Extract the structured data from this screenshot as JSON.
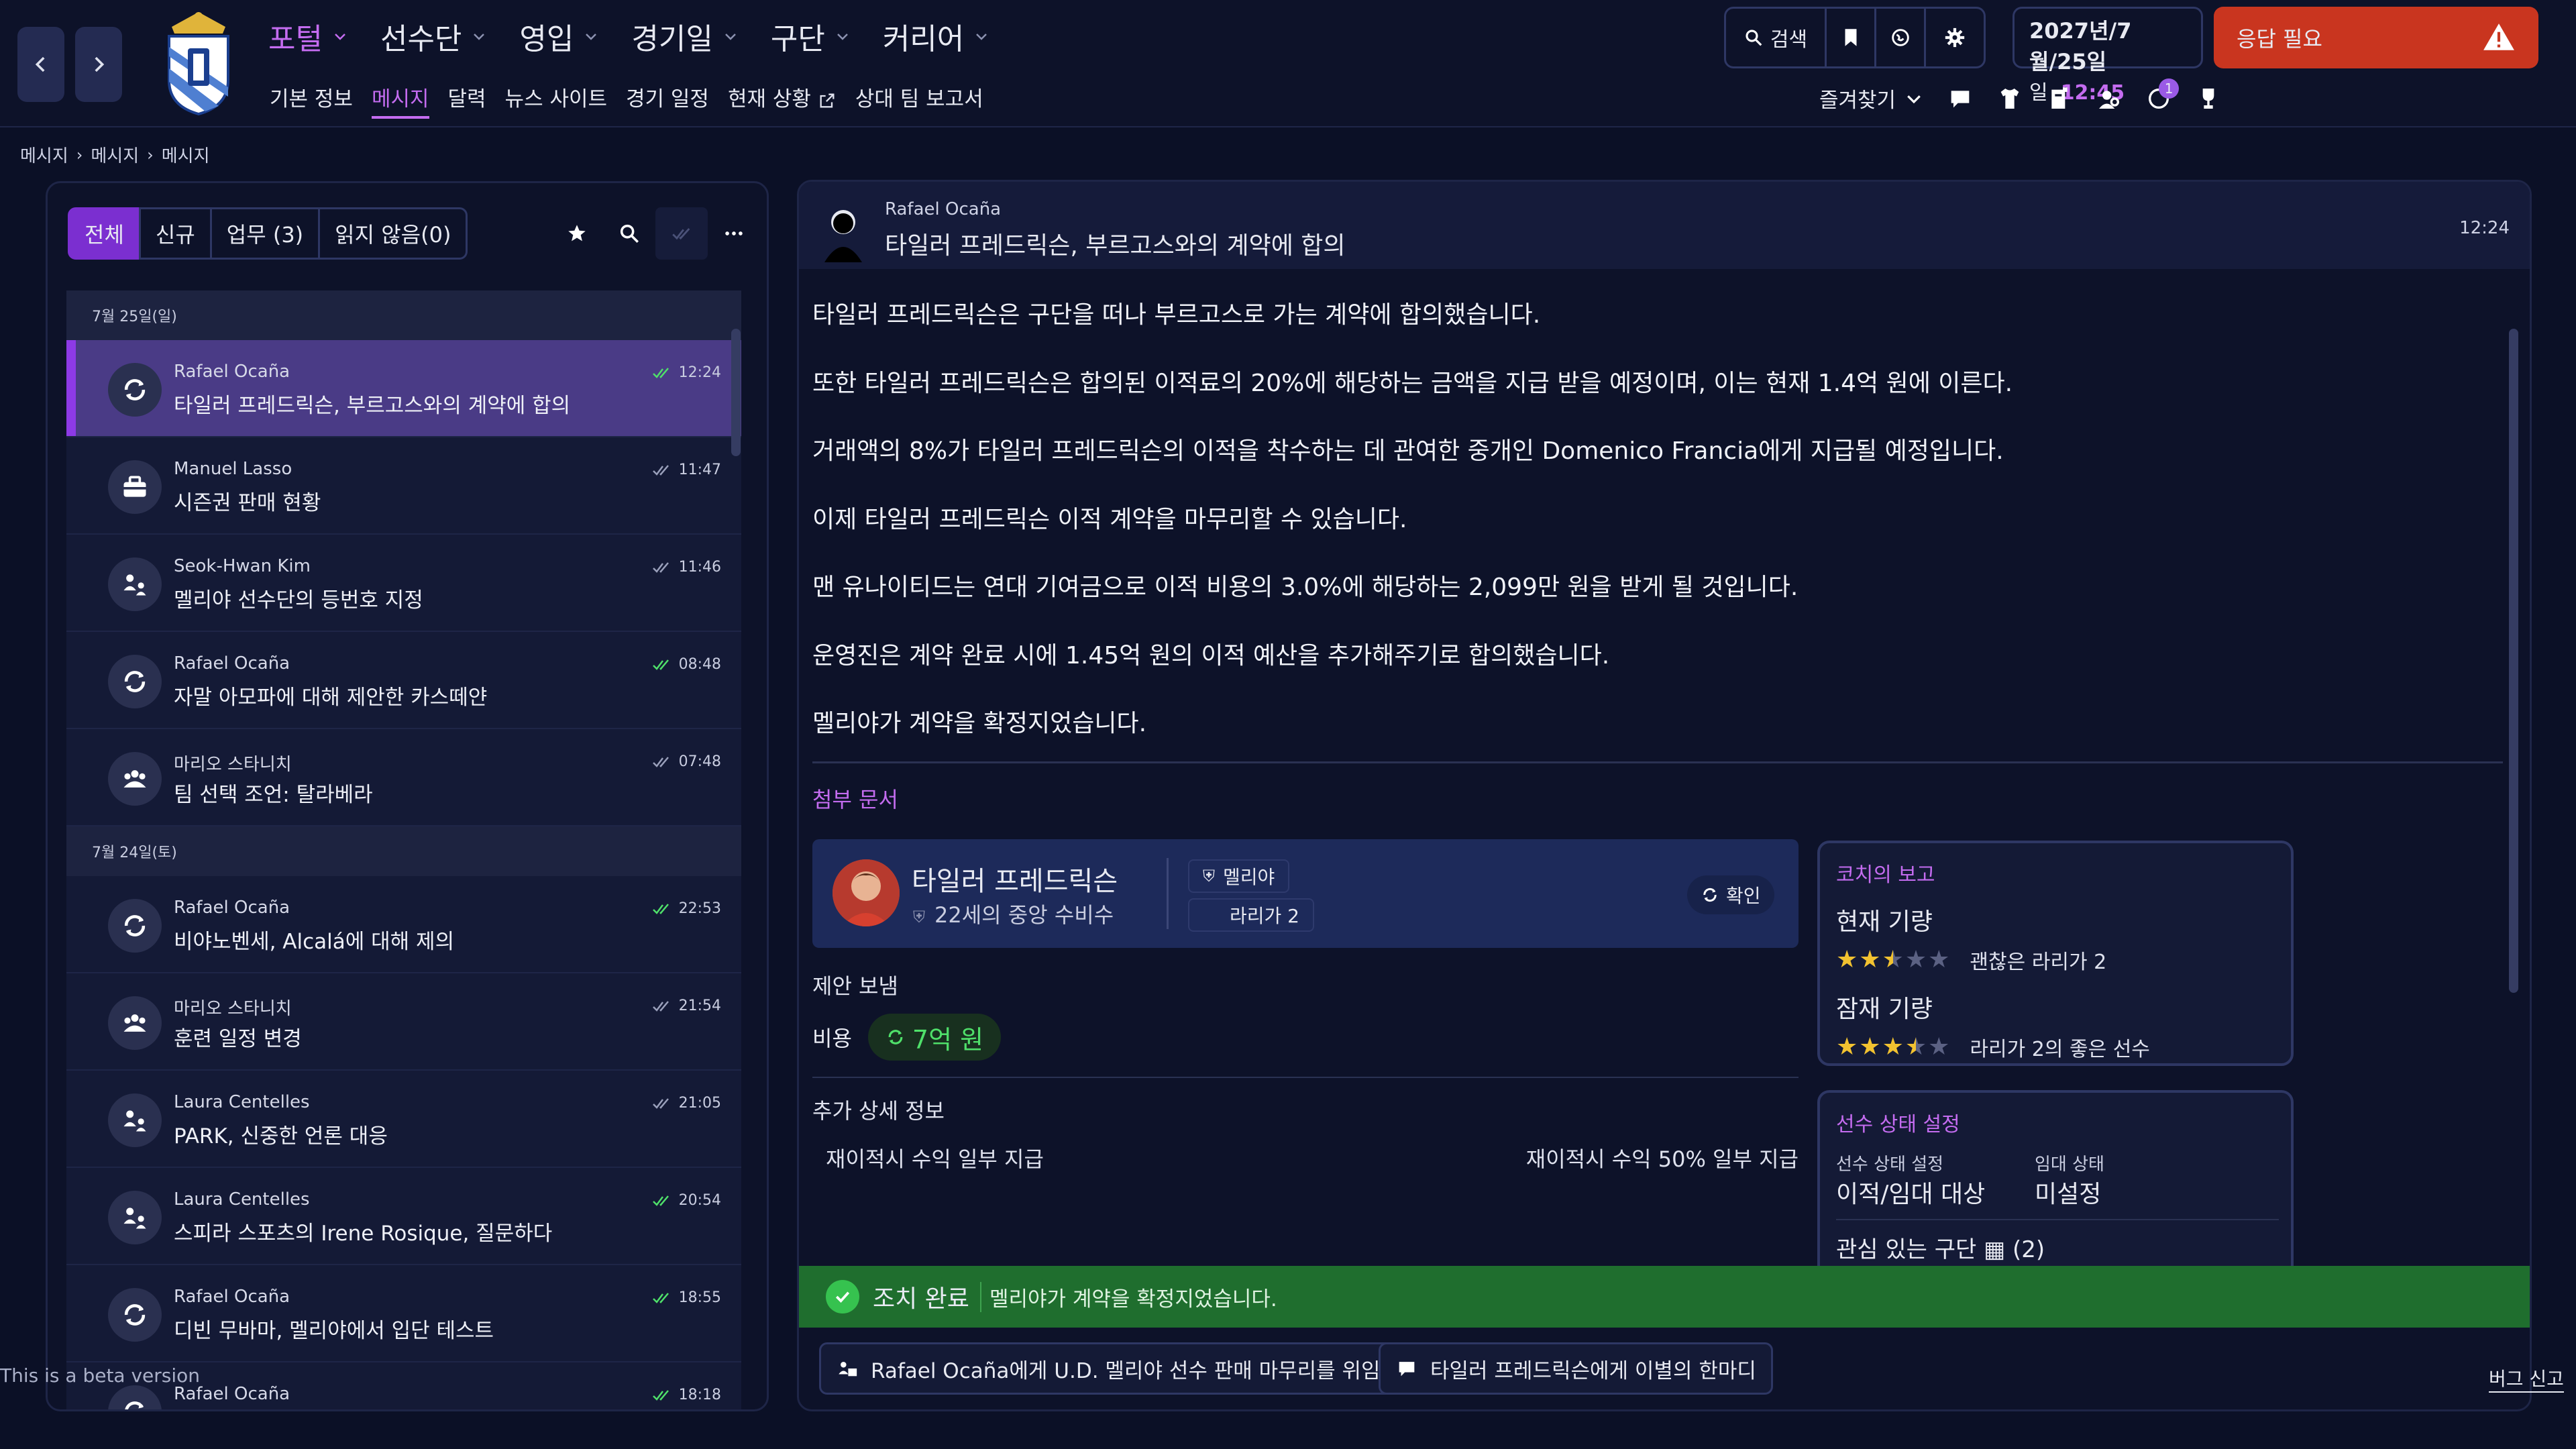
{
  "header": {
    "main_nav": [
      {
        "label": "포털",
        "active": true
      },
      {
        "label": "선수단",
        "active": false
      },
      {
        "label": "영입",
        "active": false
      },
      {
        "label": "경기일",
        "active": false
      },
      {
        "label": "구단",
        "active": false
      },
      {
        "label": "커리어",
        "active": false
      }
    ],
    "sub_nav": [
      {
        "label": "기본 정보",
        "active": false
      },
      {
        "label": "메시지",
        "active": true
      },
      {
        "label": "달력",
        "active": false
      },
      {
        "label": "뉴스 사이트",
        "active": false
      },
      {
        "label": "경기 일정",
        "active": false
      },
      {
        "label": "현재 상황",
        "active": false
      },
      {
        "label": "상대 팀 보고서",
        "active": false
      }
    ],
    "search_label": "검색",
    "date_line1": "2027년/7월/25일",
    "date_day": "일",
    "date_time": "12:45",
    "alert_label": "응답 필요",
    "favorites_label": "즐겨찾기",
    "notification_count": "1"
  },
  "breadcrumb": [
    "메시지",
    "메시지",
    "메시지"
  ],
  "inbox": {
    "tabs": [
      {
        "label": "전체",
        "active": true
      },
      {
        "label": "신규",
        "active": false
      },
      {
        "label": "업무 (3)",
        "active": false
      },
      {
        "label": "읽지 않음(0)",
        "active": false
      }
    ],
    "groups": [
      {
        "date": "7월 25일(일)",
        "messages": [
          {
            "from": "Rafael Ocaña",
            "subject": "타일러 프레드릭슨, 부르고스와의 계약에 합의",
            "time": "12:24",
            "icon": "transfer-icon",
            "read_color": "#4fe06a",
            "selected": true
          },
          {
            "from": "Manuel Lasso",
            "subject": "시즌권 판매 현황",
            "time": "11:47",
            "icon": "briefcase-icon",
            "read_color": "#9aa0bb",
            "selected": false
          },
          {
            "from": "Seok-Hwan Kim",
            "subject": "멜리야 선수단의 등번호 지정",
            "time": "11:46",
            "icon": "people-swap-icon",
            "read_color": "#9aa0bb",
            "selected": false
          },
          {
            "from": "Rafael Ocaña",
            "subject": "자말 아모파에 대해 제안한 카스떼얀",
            "time": "08:48",
            "icon": "transfer-icon",
            "read_color": "#4fe06a",
            "selected": false
          },
          {
            "from": "마리오 스타니치",
            "subject": "팀 선택 조언: 탈라베라",
            "time": "07:48",
            "icon": "team-icon",
            "read_color": "#9aa0bb",
            "selected": false
          }
        ]
      },
      {
        "date": "7월 24일(토)",
        "messages": [
          {
            "from": "Rafael Ocaña",
            "subject": "비야노벤세, Alcalá에 대해 제의",
            "time": "22:53",
            "icon": "transfer-icon",
            "read_color": "#4fe06a",
            "selected": false
          },
          {
            "from": "마리오 스타니치",
            "subject": "훈련 일정 변경",
            "time": "21:54",
            "icon": "team-icon",
            "read_color": "#9aa0bb",
            "selected": false
          },
          {
            "from": "Laura Centelles",
            "subject": "PARK, 신중한 언론 대응",
            "time": "21:05",
            "icon": "people-swap-icon",
            "read_color": "#9aa0bb",
            "selected": false
          },
          {
            "from": "Laura Centelles",
            "subject": "스피라 스포츠의 Irene Rosique, 질문하다",
            "time": "20:54",
            "icon": "people-swap-icon",
            "read_color": "#4fe06a",
            "selected": false
          },
          {
            "from": "Rafael Ocaña",
            "subject": "디빈 무바마, 멜리야에서 입단 테스트",
            "time": "18:55",
            "icon": "transfer-icon",
            "read_color": "#4fe06a",
            "selected": false
          },
          {
            "from": "Rafael Ocaña",
            "subject": "",
            "time": "18:18",
            "icon": "transfer-icon",
            "read_color": "#4fe06a",
            "selected": false
          }
        ]
      }
    ]
  },
  "message": {
    "from": "Rafael Ocaña",
    "subject": "타일러 프레드릭슨, 부르고스와의 계약에 합의",
    "time": "12:24",
    "body": [
      "타일러 프레드릭슨은 구단을 떠나 부르고스로 가는 계약에 합의했습니다.",
      "또한 타일러 프레드릭슨은 합의된 이적료의 20%에 해당하는 금액을 지급 받을 예정이며, 이는 현재 1.4억 원에 이른다.",
      "거래액의 8%가 타일러 프레드릭슨의 이적을 착수하는 데 관여한 중개인 Domenico Francia에게 지급될 예정입니다.",
      "이제 타일러 프레드릭슨 이적 계약을 마무리할 수 있습니다.",
      "맨 유나이티드는 연대 기여금으로 이적 비용의 3.0%에 해당하는 2,099만 원을 받게 될 것입니다.",
      "운영진은 계약 완료 시에 1.45억 원의 이적 예산을 추가해주기로 합의했습니다.",
      "멜리야가 계약을 확정지었습니다."
    ],
    "attachments_label": "첨부 문서",
    "player": {
      "name": "타일러 프레드릭슨",
      "info": "22세의 중앙 수비수",
      "club": "멜리야",
      "league": "라리가 2",
      "confirm_label": "확인"
    },
    "offer_label": "제안 보냄",
    "cost_label": "비용",
    "cost_value": "7억 원",
    "more_details_label": "추가 상세 정보",
    "detail_left": "재이적시 수익 일부 지급",
    "detail_right": "재이적시 수익 50% 일부 지급",
    "coach_report": {
      "title": "코치의 보고",
      "current_label": "현재 기량",
      "current_stars": 2.5,
      "current_text": "괜찮은 라리가 2",
      "potential_label": "잠재 기량",
      "potential_stars": 3.5,
      "potential_text": "라리가 2의 좋은 선수"
    },
    "player_status": {
      "title": "선수 상태 설정",
      "status_label": "선수 상태 설정",
      "status_value": "이적/임대 대상",
      "loan_label": "임대 상태",
      "loan_value": "미설정",
      "interest_label": "관심 있는 구단 ▦ (2)"
    },
    "done_title": "조치 완료",
    "done_message": "멜리야가 계약을 확정지었습니다.",
    "actions": [
      "Rafael Ocaña에게 U.D. 멜리야 선수 판매 마무리를 위임",
      "타일러 프레드릭슨에게 이별의 한마디"
    ]
  },
  "footer": {
    "beta_label": "This is a beta version",
    "bug_label": "버그 신고"
  },
  "colors": {
    "accent": "#c46cf0",
    "selected_bg": "#4a3b86",
    "success": "#1f6e2e",
    "alert": "#c9351f"
  }
}
